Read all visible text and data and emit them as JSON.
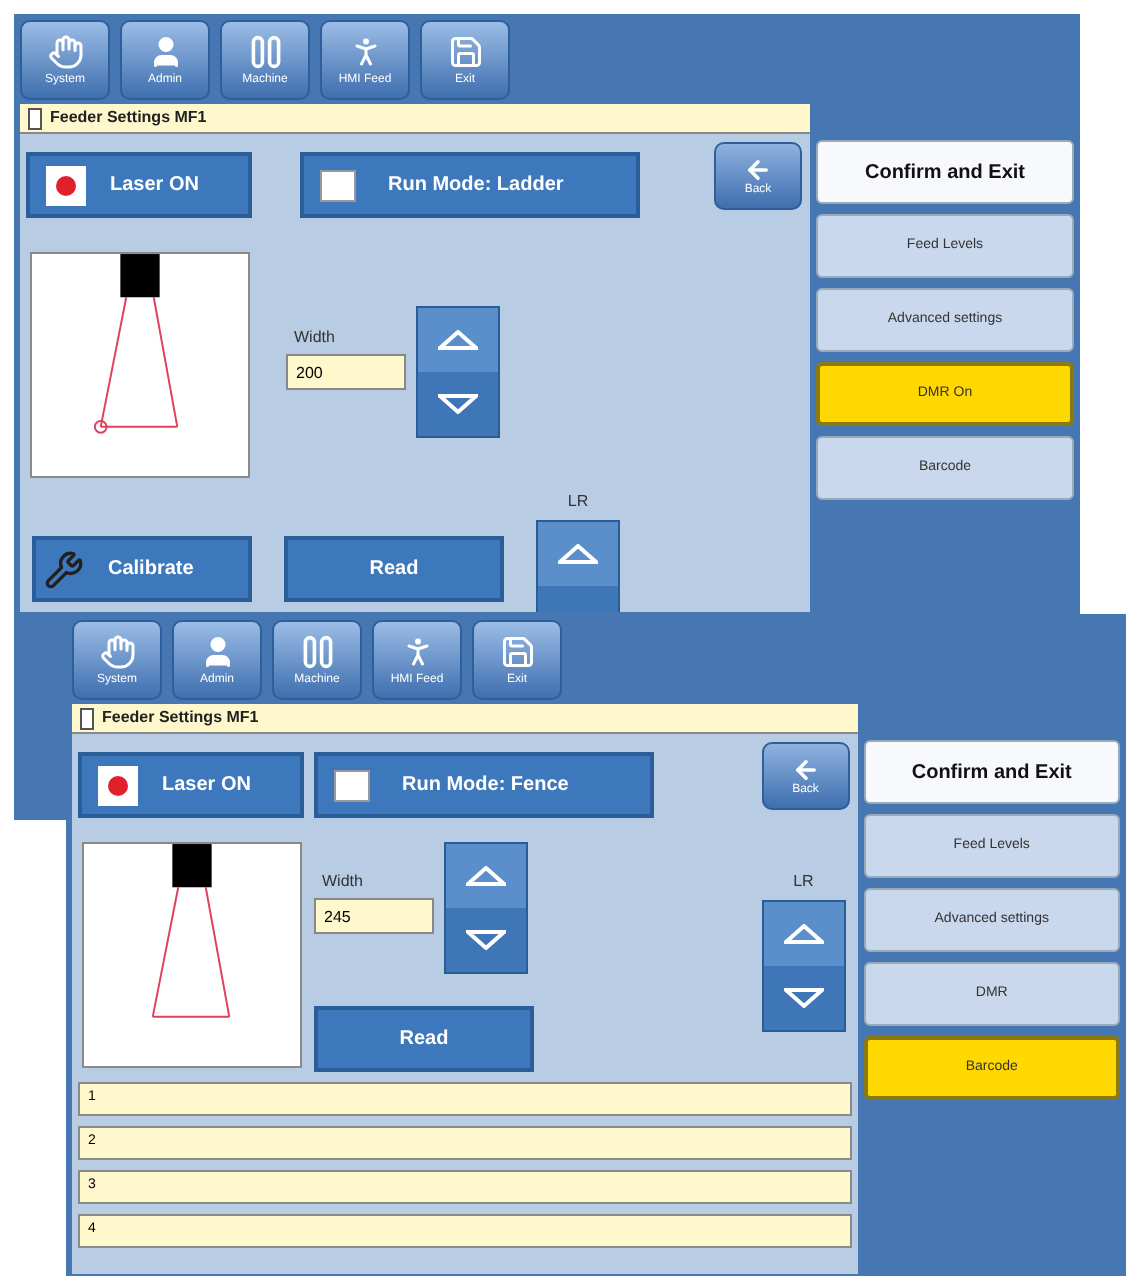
{
  "windows": [
    {
      "kind": "ladder",
      "toolbar": [
        {
          "label": "System"
        },
        {
          "label": "Admin"
        },
        {
          "label": "Machine"
        },
        {
          "label": "HMI Feed"
        },
        {
          "label": "Exit"
        }
      ],
      "title": "Feeder Settings MF1",
      "laser_button": {
        "label": "Laser ON"
      },
      "mode_button": {
        "label": "Run Mode: Ladder"
      },
      "back_button": {
        "label": "Back"
      },
      "width": {
        "label": "Width",
        "value": "200"
      },
      "lr_label": "LR",
      "action_buttons": [
        {
          "kind": "calibrate",
          "label": "Calibrate"
        },
        {
          "kind": "read",
          "label": "Read"
        }
      ],
      "side_buttons": [
        {
          "label": "Confirm and Exit",
          "kind": "confirm",
          "selected": false
        },
        {
          "label": "Feed Levels",
          "kind": "option",
          "selected": false
        },
        {
          "label": "Advanced settings",
          "kind": "option",
          "selected": false
        },
        {
          "label": "DMR On",
          "kind": "option",
          "selected": true
        },
        {
          "label": "Barcode",
          "kind": "option",
          "selected": false
        }
      ]
    },
    {
      "kind": "fence",
      "toolbar": [
        {
          "label": "System"
        },
        {
          "label": "Admin"
        },
        {
          "label": "Machine"
        },
        {
          "label": "HMI Feed"
        },
        {
          "label": "Exit"
        }
      ],
      "title": "Feeder Settings MF1",
      "laser_button": {
        "label": "Laser ON"
      },
      "mode_button": {
        "label": "Run Mode: Fence"
      },
      "back_button": {
        "label": "Back"
      },
      "width": {
        "label": "Width",
        "value": "245"
      },
      "lr_label": "LR",
      "action_buttons": [
        {
          "kind": "read",
          "label": "Read"
        }
      ],
      "side_buttons": [
        {
          "label": "Confirm and Exit",
          "kind": "confirm",
          "selected": false
        },
        {
          "label": "Feed Levels",
          "kind": "option",
          "selected": false
        },
        {
          "label": "Advanced settings",
          "kind": "option",
          "selected": false
        },
        {
          "label": "DMR",
          "kind": "option",
          "selected": false
        },
        {
          "label": "Barcode",
          "kind": "option",
          "selected": true
        }
      ],
      "lines": [
        "1",
        "2",
        "3",
        "4"
      ]
    }
  ]
}
